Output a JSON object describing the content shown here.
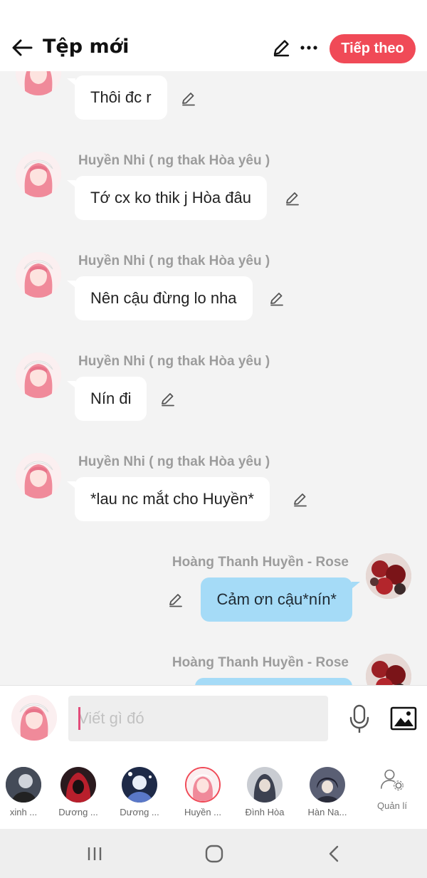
{
  "header": {
    "title": "Tệp mới",
    "next_label": "Tiếp theo",
    "accent": "#f04a57"
  },
  "messages": [
    {
      "side": "left",
      "name": "",
      "text": "Thôi đc r"
    },
    {
      "side": "left",
      "name": "Huyền Nhi ( ng thak Hòa yêu )",
      "text": "Tớ cx ko thik j Hòa đâu"
    },
    {
      "side": "left",
      "name": "Huyền Nhi ( ng thak Hòa yêu )",
      "text": "Nên cậu đừng lo nha"
    },
    {
      "side": "left",
      "name": "Huyền Nhi ( ng thak Hòa yêu )",
      "text": "Nín đi"
    },
    {
      "side": "left",
      "name": "Huyền Nhi ( ng thak Hòa yêu )",
      "text": "*lau nc mắt cho Huyền*"
    },
    {
      "side": "right",
      "name": "Hoàng Thanh Huyền - Rose",
      "text": "Cảm ơn cậu*nín*"
    },
    {
      "side": "right",
      "name": "Hoàng Thanh Huyền - Rose",
      "text": ""
    }
  ],
  "input": {
    "placeholder": "Viết gì đó",
    "value": ""
  },
  "members": [
    {
      "label": "xinh ...",
      "icon": "dark-character-avatar"
    },
    {
      "label": "Dương ...",
      "icon": "red-hood-avatar"
    },
    {
      "label": "Dương ...",
      "icon": "blue-character-avatar"
    },
    {
      "label": "Huyền ...",
      "icon": "pink-hair-avatar"
    },
    {
      "label": "Đình Hòa",
      "icon": "hooded-boy-avatar"
    },
    {
      "label": "Hàn Na...",
      "icon": "dark-hair-avatar"
    }
  ],
  "manage_label": "Quản lí",
  "colors": {
    "left_bubble": "#ffffff",
    "right_bubble": "#a5dbf7",
    "background": "#f3f3f3"
  }
}
